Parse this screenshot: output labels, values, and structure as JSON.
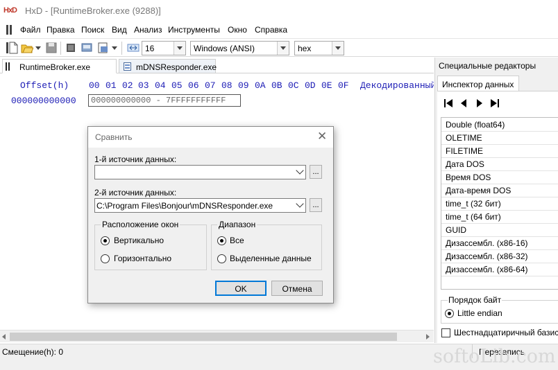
{
  "window": {
    "app_logo": "HxD",
    "title": "HxD - [RuntimeBroker.exe (9288)]"
  },
  "menu": [
    "Файл",
    "Правка",
    "Поиск",
    "Вид",
    "Анализ",
    "Инструменты",
    "Окно",
    "Справка"
  ],
  "toolbar": {
    "bytes_per_row": "16",
    "charset": "Windows (ANSI)",
    "offset_base": "hex"
  },
  "tabs": [
    {
      "label": "RuntimeBroker.exe (9288)",
      "active": true
    },
    {
      "label": "mDNSResponder.exe",
      "active": false
    }
  ],
  "hex_view": {
    "offset_header": "Offset(h)",
    "columns": [
      "00",
      "01",
      "02",
      "03",
      "04",
      "05",
      "06",
      "07",
      "08",
      "09",
      "0A",
      "0B",
      "0C",
      "0D",
      "0E",
      "0F"
    ],
    "decoded_header": "Декодированный",
    "first_offset": "000000000000",
    "range_text": "000000000000 - 7FFFFFFFFFFF"
  },
  "status": {
    "offset": "Смещение(h): 0",
    "mode": "Перезапись",
    "watermark": "softoLib.com"
  },
  "right_panel": {
    "title": "Специальные редакторы",
    "tab": "Инспектор данных",
    "nav_icons": [
      "first-icon",
      "prev-icon",
      "next-icon",
      "last-icon"
    ],
    "inspector_items": [
      "Double (float64)",
      "OLETIME",
      "FILETIME",
      "Дата DOS",
      "Время DOS",
      "Дата-время DOS",
      "time_t (32 бит)",
      "time_t (64 бит)",
      "GUID",
      "Дизассембл. (x86-16)",
      "Дизассембл. (x86-32)",
      "Дизассембл. (x86-64)"
    ],
    "byte_order_caption": "Порядок байт",
    "little_endian": "Little endian",
    "hex_base_checkbox": "Шестнадцатиричный базис"
  },
  "dialog": {
    "title": "Сравнить",
    "source1_label": "1-й источник данных:",
    "source1_value": "",
    "source2_label": "2-й источник данных:",
    "source2_value": "C:\\Program Files\\Bonjour\\mDNSResponder.exe",
    "browse_label": "...",
    "layout_group": "Расположение окон",
    "layout_vertical": "Вертикально",
    "layout_horizontal": "Горизонтально",
    "range_group": "Диапазон",
    "range_all": "Все",
    "range_selected": "Выделенные данные",
    "ok": "OK",
    "cancel": "Отмена"
  },
  "colors": {
    "hex_header": "#1b1bb5",
    "dialog_bg": "#f0f0f0",
    "primary_button_border": "#0078d7"
  }
}
